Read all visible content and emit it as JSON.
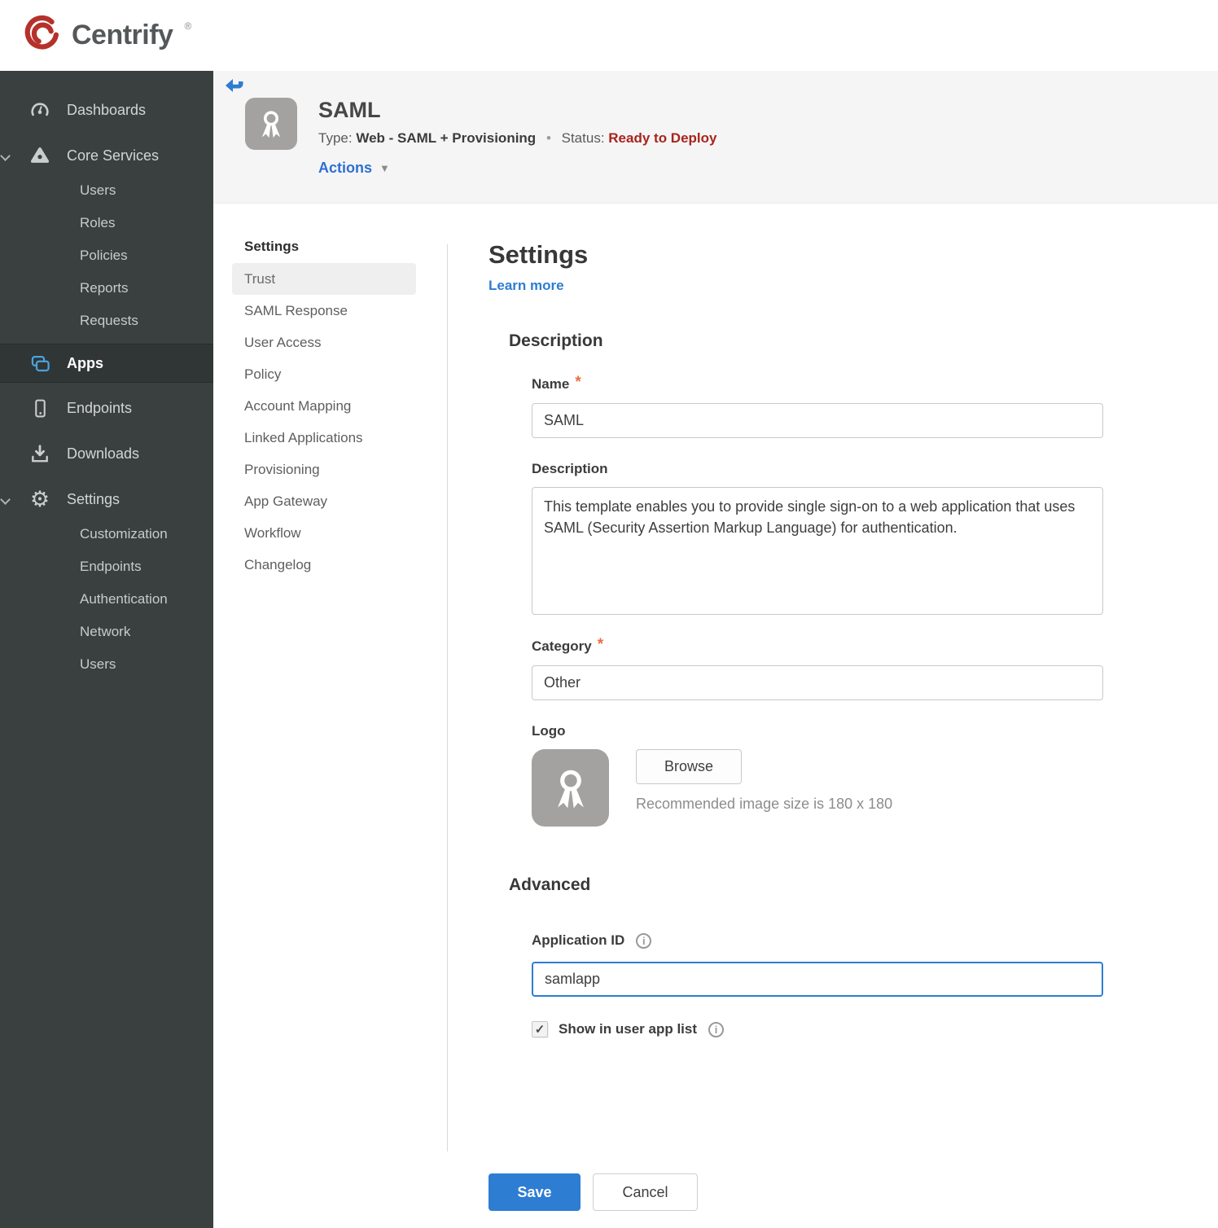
{
  "brand": {
    "name": "Centrify",
    "trademark": "®"
  },
  "sidebar": {
    "items": [
      {
        "label": "Dashboards"
      },
      {
        "label": "Core Services",
        "children": [
          "Users",
          "Roles",
          "Policies",
          "Reports",
          "Requests"
        ]
      },
      {
        "label": "Apps"
      },
      {
        "label": "Endpoints"
      },
      {
        "label": "Downloads"
      },
      {
        "label": "Settings",
        "children": [
          "Customization",
          "Endpoints",
          "Authentication",
          "Network",
          "Users"
        ]
      }
    ],
    "active_item": "Apps"
  },
  "header": {
    "app_title": "SAML",
    "type_label": "Type:",
    "type_value": "Web - SAML + Provisioning",
    "separator": "•",
    "status_label": "Status:",
    "status_value": "Ready to Deploy",
    "actions_label": "Actions"
  },
  "subnav": {
    "title": "Settings",
    "selected": "Trust",
    "items": [
      "Trust",
      "SAML Response",
      "User Access",
      "Policy",
      "Account Mapping",
      "Linked Applications",
      "Provisioning",
      "App Gateway",
      "Workflow",
      "Changelog"
    ]
  },
  "main": {
    "title": "Settings",
    "learn_more": "Learn more",
    "required_marker": "*",
    "description_section": {
      "heading": "Description",
      "name_label": "Name",
      "name_value": "SAML",
      "description_label": "Description",
      "description_value": "This template enables you to provide single sign-on to a web application that uses SAML (Security Assertion Markup Language) for authentication.",
      "category_label": "Category",
      "category_value": "Other",
      "logo_label": "Logo",
      "browse_label": "Browse",
      "logo_hint": "Recommended image size is 180 x 180"
    },
    "advanced_section": {
      "heading": "Advanced",
      "app_id_label": "Application ID",
      "app_id_value": "samlapp",
      "show_in_list_label": "Show in user app list",
      "show_in_list_checked": true
    },
    "buttons": {
      "save": "Save",
      "cancel": "Cancel"
    }
  },
  "colors": {
    "accent_blue": "#2d7dd2",
    "status_red": "#a8241c",
    "apps_icon_blue": "#4aa3dd",
    "required_orange": "#e8703d",
    "sidebar_bg": "#3a3f3f"
  }
}
